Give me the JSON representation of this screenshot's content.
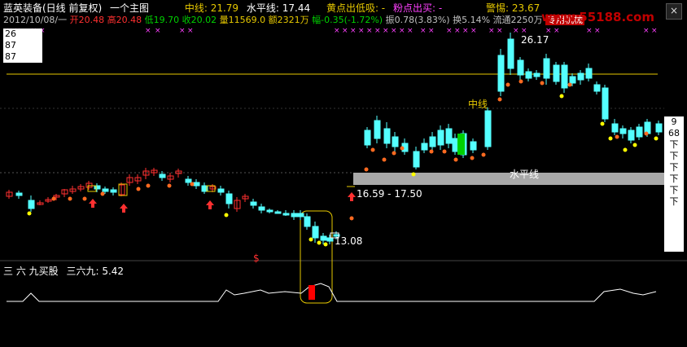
{
  "header": {
    "title": "蓝英装备(日线 前复权)",
    "template_label": "一个主图",
    "zhongxian_label": "中线: 21.79",
    "shuipingxian_label": "水平线: 17.44",
    "huang_dian_label": "黄点出低吸: -",
    "fen_dian_label": "粉点出买: -",
    "jingti_label": "警惕: 23.67"
  },
  "quote": {
    "date": "2012/10/08/一",
    "open": "开20.48",
    "high": "高20.48",
    "low": "低19.70",
    "close": "收20.02",
    "volume": "量11569.0",
    "amount": "额2321万",
    "change": "幅-0.35(-1.72%)",
    "amplitude": "振0.78(3.83%)",
    "turnover": "换5.14%",
    "float_shares": "流通2250万",
    "special_label": "专用机械"
  },
  "watermark": "www.55188.com",
  "close_icon_glyph": "×",
  "popup_values": [
    "26",
    "87",
    "87"
  ],
  "chart_labels": {
    "peak_price": "26.17",
    "zhongxian_tag": "中线",
    "shuiping_tag": "水平线",
    "range_label": "16.59 - 17.50",
    "low_price": "13.08",
    "dollar_sign": "$"
  },
  "right_panel": [
    "9",
    "68",
    "下",
    "下",
    "下",
    "下",
    "下",
    "下"
  ],
  "indicator": {
    "label": "三 六 九买股",
    "value_label": "三六九: 5.42"
  },
  "colors": {
    "up": "#ff3030",
    "down": "#54ffff",
    "gold": "#e6c800",
    "pink": "#ff40ff",
    "gray_band": "#a8a8a8",
    "green_bar": "#00d000"
  }
}
